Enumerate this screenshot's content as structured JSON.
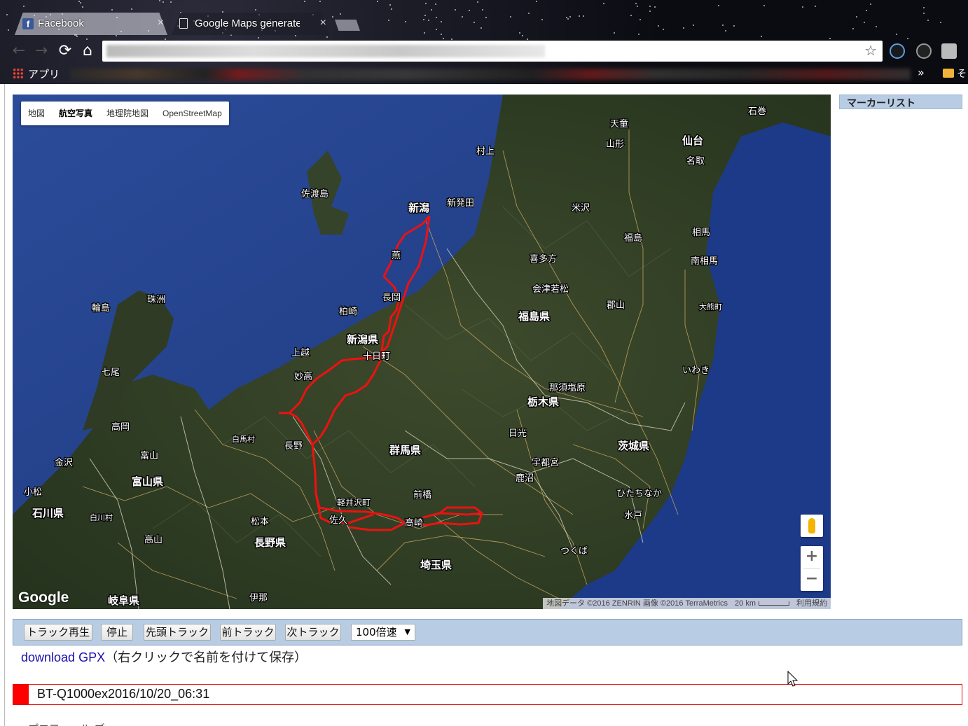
{
  "browser": {
    "tabs": [
      {
        "label": "Facebook",
        "active": true
      },
      {
        "label": "Google Maps generate",
        "active": false
      }
    ],
    "bookmarks": {
      "apps_label": "アプリ",
      "more": "»",
      "folder_label": "そ"
    }
  },
  "map": {
    "map_types": [
      "地図",
      "航空写真",
      "地理院地図",
      "OpenStreetMap"
    ],
    "active_map_type": "航空写真",
    "google_logo": "Google",
    "attribution": {
      "data": "地図データ ©2016 ZENRIN 画像 ©2016 TerraMetrics",
      "scale": "20 km",
      "terms": "利用規約"
    },
    "zoom_in": "+",
    "zoom_out": "−",
    "place_labels_big": [
      "新潟",
      "新潟県",
      "福島県",
      "仙台",
      "栃木県",
      "群馬県",
      "茨城県",
      "富山県",
      "石川県",
      "長野県",
      "埼玉県",
      "岐阜県"
    ],
    "place_labels_small": [
      "天童",
      "山形",
      "石巻",
      "名取",
      "村上",
      "新発田",
      "米沢",
      "佐渡島",
      "燕",
      "喜多方",
      "相馬",
      "南相馬",
      "福島",
      "会津若松",
      "郡山",
      "長岡",
      "柏崎",
      "十日町",
      "上越",
      "妙高",
      "大熊町",
      "いわき",
      "輪島",
      "珠洲",
      "七尾",
      "那須塩原",
      "日光",
      "高岡",
      "金沢",
      "富山",
      "白馬村",
      "長野",
      "宇都宮",
      "鹿沼",
      "小松",
      "白川村",
      "ひたちなか",
      "水戸",
      "前橋",
      "軽井沢町",
      "佐久",
      "高崎",
      "松本",
      "高山",
      "つくば",
      "伊那"
    ],
    "route_color": "#ee1111"
  },
  "marker_list": {
    "title": "マーカーリスト"
  },
  "controls": {
    "buttons": [
      "トラック再生",
      "停止",
      "先頭トラック",
      "前トラック",
      "次トラック"
    ],
    "speed": "100倍速"
  },
  "download": {
    "link": "download GPX",
    "note": "（右クリックで名前を付けて保存）"
  },
  "track": {
    "name": "BT-Q1000ex2016/10/20_06:31",
    "color": "#ff0000"
  },
  "footer": {
    "text": "プロフィール ブ"
  }
}
